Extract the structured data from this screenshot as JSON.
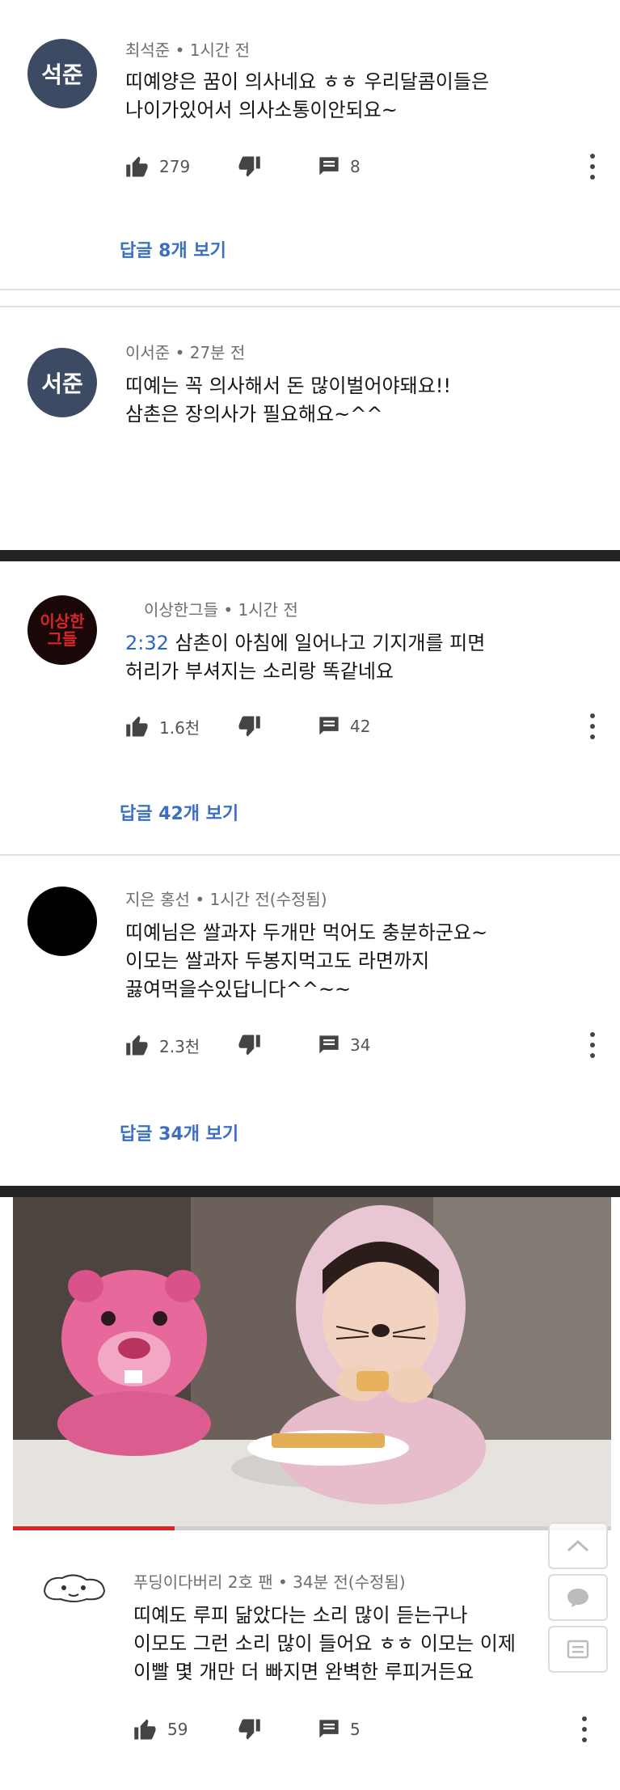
{
  "comments": [
    {
      "avatar_text": "석준",
      "avatar_color": "#3c4b63",
      "author": "최석준",
      "time": "• 1시간 전",
      "text": "띠예양은 꿈이 의사네요 ㅎㅎ 우리달콤이들은\n나이가있어서 의사소통이안되요~",
      "likes": "279",
      "replies_count": "8",
      "view_replies": "답글 8개 보기"
    },
    {
      "avatar_text": "서준",
      "avatar_color": "#3c4b63",
      "author": "이서준",
      "time": "• 27분 전",
      "text": "띠예는 꼭 의사해서 돈 많이벌어야돼요!!\n삼촌은 장의사가 필요해요~^^"
    },
    {
      "avatar_text": "이상한그들",
      "avatar_color": "#1a0808",
      "author": "이상한그들",
      "time": "• 1시간 전",
      "timestamp": "2:32",
      "text": " 삼촌이 아침에 일어나고 기지개를 피면\n허리가 부셔지는 소리랑 똑같네요",
      "likes": "1.6천",
      "replies_count": "42",
      "view_replies": "답글 42개 보기"
    },
    {
      "avatar_color": "#000000",
      "author": "지은 홍선",
      "time": "• 1시간 전(수정됨)",
      "text": "띠예님은 쌀과자 두개만 먹어도 충분하군요~\n이모는 쌀과자 두봉지먹고도 라면까지\n끓여먹을수있답니다^^~~",
      "likes": "2.3천",
      "replies_count": "34",
      "view_replies": "답글 34개 보기"
    },
    {
      "author": "푸딩이다버리 2호 팬",
      "time": "• 34분 전(수정됨)",
      "text": "띠예도 루피 닮았다는 소리 많이 듣는구나\n이모도 그런 소리 많이 들어요 ㅎㅎ 이모는 이제\n이빨 몇 개만 더 빠지면 완벽한 루피거든요",
      "likes": "59",
      "replies_count": "5"
    }
  ],
  "video": {
    "progress_fraction": 0.27
  },
  "colors": {
    "link": "#3b6fc0",
    "timestamp": "#2a65c6",
    "progress": "#e02323"
  },
  "icons": [
    "thumbs-up-icon",
    "thumbs-down-icon",
    "reply-icon",
    "more-vert-icon",
    "chevron-up-icon",
    "chat-bubble-icon",
    "list-icon"
  ]
}
